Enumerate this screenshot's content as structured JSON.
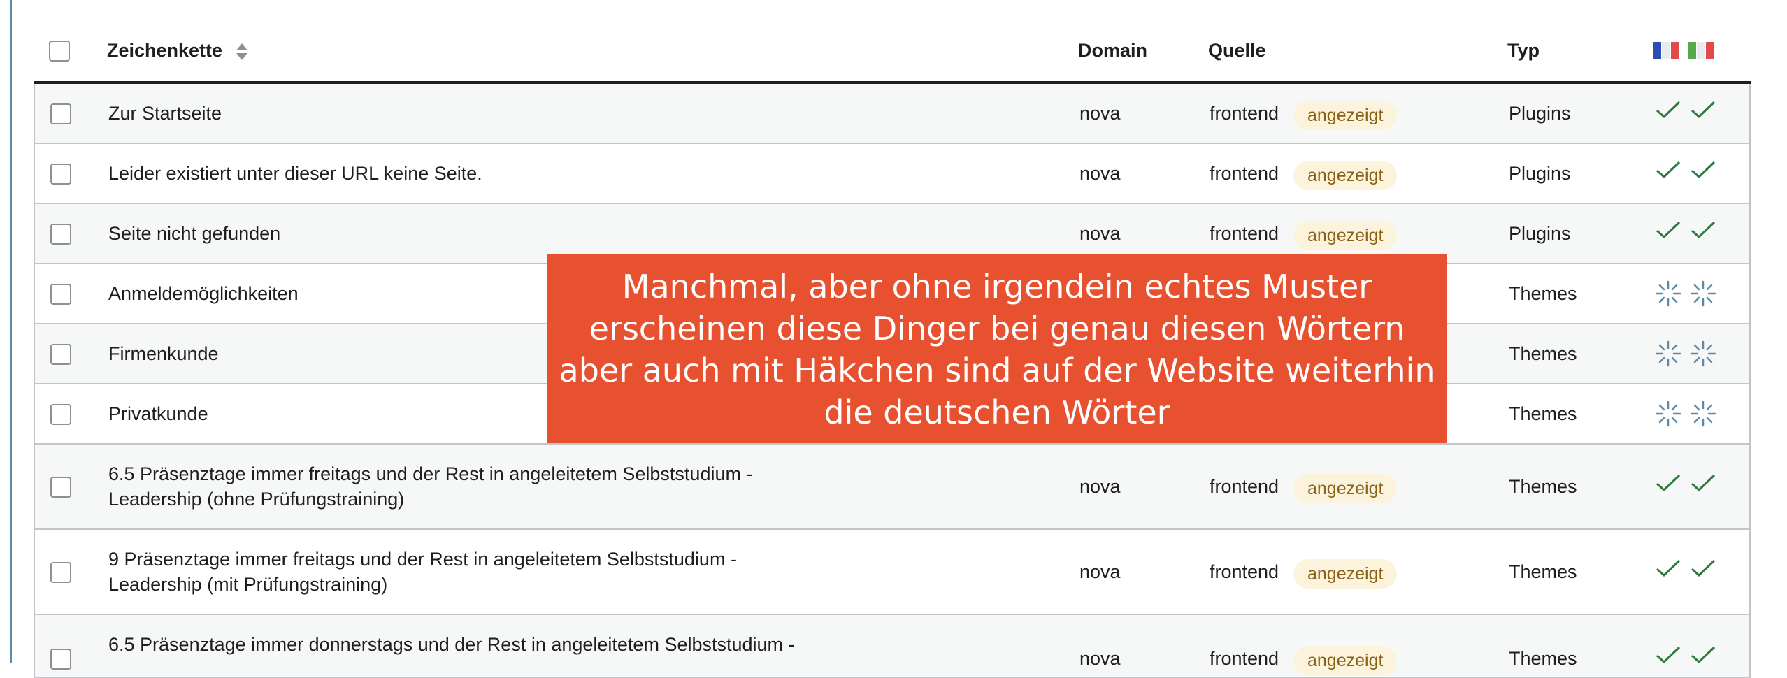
{
  "header": {
    "string_label": "Zeichenkette",
    "domain_label": "Domain",
    "source_label": "Quelle",
    "type_label": "Typ",
    "flag_icons": [
      "flag-france-icon",
      "flag-italy-icon"
    ]
  },
  "colors": {
    "accent_overlay": "#e8512f",
    "badge_bg": "#fcf3dc",
    "badge_text": "#8a6116",
    "check_green": "#2a7a3e",
    "spinner_blue": "#5c8aa6"
  },
  "rows": [
    {
      "string": "Zur Startseite",
      "domain": "nova",
      "source": "frontend",
      "badge": "angezeigt",
      "type": "Plugins",
      "status": "check"
    },
    {
      "string": "Leider existiert unter dieser URL keine Seite.",
      "domain": "nova",
      "source": "frontend",
      "badge": "angezeigt",
      "type": "Plugins",
      "status": "check"
    },
    {
      "string": "Seite nicht gefunden",
      "domain": "nova",
      "source": "frontend",
      "badge": "angezeigt",
      "type": "Plugins",
      "status": "check"
    },
    {
      "string": "Anmeldemöglichkeiten",
      "type": "Themes",
      "status": "spinner"
    },
    {
      "string": "Firmenkunde",
      "type": "Themes",
      "status": "spinner"
    },
    {
      "string": "Privatkunde",
      "type": "Themes",
      "status": "spinner"
    },
    {
      "string_line1": "6.5 Präsenztage immer freitags und der Rest in angeleitetem Selbststudium -",
      "string_line2": "Leadership (ohne Prüfungstraining)",
      "domain": "nova",
      "source": "frontend",
      "badge": "angezeigt",
      "type": "Themes",
      "status": "check"
    },
    {
      "string_line1": "9 Präsenztage immer freitags und der Rest in angeleitetem Selbststudium -",
      "string_line2": "Leadership (mit Prüfungstraining)",
      "domain": "nova",
      "source": "frontend",
      "badge": "angezeigt",
      "type": "Themes",
      "status": "check"
    },
    {
      "string_line1": "6.5 Präsenztage immer donnerstags und der Rest in angeleitetem Selbststudium -",
      "domain": "nova",
      "source": "frontend",
      "badge": "angezeigt",
      "type": "Themes",
      "status": "check"
    }
  ],
  "overlay": {
    "lines": [
      "Manchmal, aber ohne irgendein echtes Muster",
      "erscheinen diese Dinger bei genau diesen Wörtern",
      "aber auch mit Häkchen sind auf der Website weiterhin",
      "die deutschen Wörter"
    ]
  }
}
